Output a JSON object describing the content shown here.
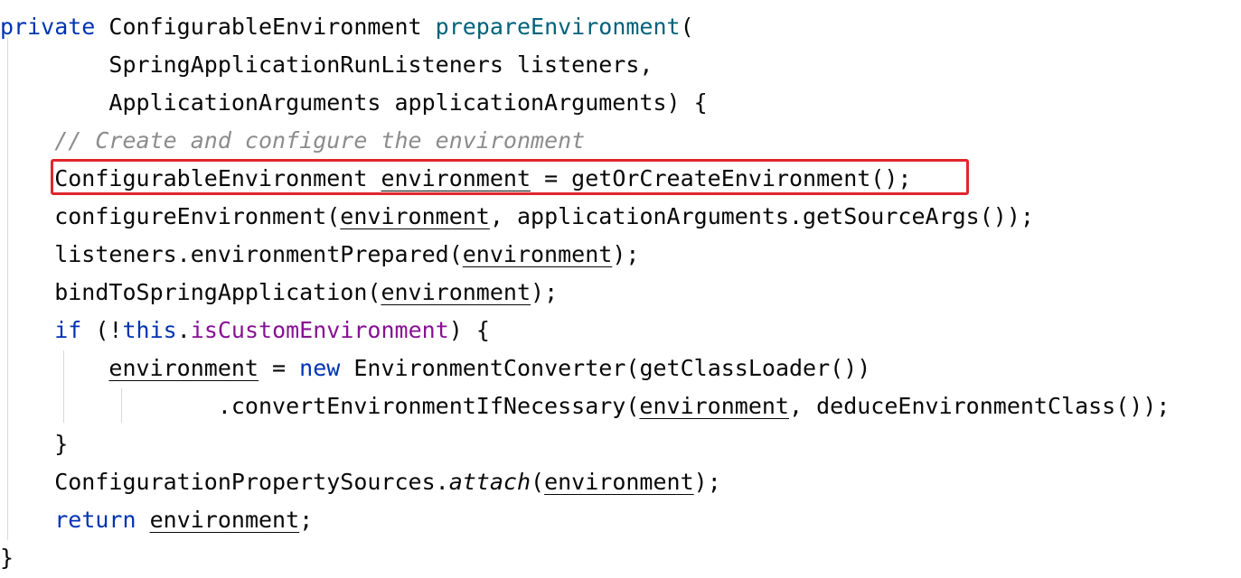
{
  "editor": {
    "lines": [
      {
        "tokens": [
          {
            "text": "private",
            "style": "kw"
          },
          {
            "text": " ConfigurableEnvironment "
          },
          {
            "text": "prepareEnvironment",
            "style": "fn"
          },
          {
            "text": "("
          }
        ]
      },
      {
        "tokens": [
          {
            "text": "        SpringApplicationRunListeners listeners,"
          }
        ]
      },
      {
        "tokens": [
          {
            "text": "        ApplicationArguments applicationArguments) {"
          }
        ]
      },
      {
        "tokens": [
          {
            "text": "    "
          },
          {
            "text": "// Create and configure the environment",
            "style": "cm"
          }
        ]
      },
      {
        "tokens": [
          {
            "text": "    ConfigurableEnvironment "
          },
          {
            "text": "environment",
            "style": "u"
          },
          {
            "text": " = getOrCreateEnvironment();"
          }
        ]
      },
      {
        "tokens": [
          {
            "text": "    configureEnvironment("
          },
          {
            "text": "environment",
            "style": "u"
          },
          {
            "text": ", applicationArguments.getSourceArgs());"
          }
        ]
      },
      {
        "tokens": [
          {
            "text": "    listeners.environmentPrepared("
          },
          {
            "text": "environment",
            "style": "u"
          },
          {
            "text": ");"
          }
        ]
      },
      {
        "tokens": [
          {
            "text": "    bindToSpringApplication("
          },
          {
            "text": "environment",
            "style": "u"
          },
          {
            "text": ");"
          }
        ]
      },
      {
        "tokens": [
          {
            "text": "    "
          },
          {
            "text": "if",
            "style": "kw"
          },
          {
            "text": " (!"
          },
          {
            "text": "this",
            "style": "kw"
          },
          {
            "text": "."
          },
          {
            "text": "isCustomEnvironment",
            "style": "fld"
          },
          {
            "text": ") {"
          }
        ]
      },
      {
        "tokens": [
          {
            "text": "        "
          },
          {
            "text": "environment",
            "style": "u"
          },
          {
            "text": " = "
          },
          {
            "text": "new",
            "style": "kw"
          },
          {
            "text": " EnvironmentConverter(getClassLoader())"
          }
        ]
      },
      {
        "tokens": [
          {
            "text": "                .convertEnvironmentIfNecessary("
          },
          {
            "text": "environment",
            "style": "u"
          },
          {
            "text": ", deduceEnvironmentClass());"
          }
        ]
      },
      {
        "tokens": [
          {
            "text": "    }"
          }
        ]
      },
      {
        "tokens": [
          {
            "text": "    ConfigurationPropertySources."
          },
          {
            "text": "attach",
            "style": "it"
          },
          {
            "text": "("
          },
          {
            "text": "environment",
            "style": "u"
          },
          {
            "text": ");"
          }
        ]
      },
      {
        "tokens": [
          {
            "text": "    "
          },
          {
            "text": "return",
            "style": "kw"
          },
          {
            "text": " "
          },
          {
            "text": "environment",
            "style": "u"
          },
          {
            "text": ";"
          }
        ]
      },
      {
        "tokens": [
          {
            "text": "}"
          }
        ]
      }
    ],
    "highlighted_line": 4,
    "highlight_color": "#e0262b",
    "colors": {
      "keyword": "#0033b3",
      "method_declaration": "#00627a",
      "comment": "#8c8c8c",
      "field": "#871094",
      "default_text": "#080808",
      "indent_guide": "#d9d9d9"
    }
  }
}
